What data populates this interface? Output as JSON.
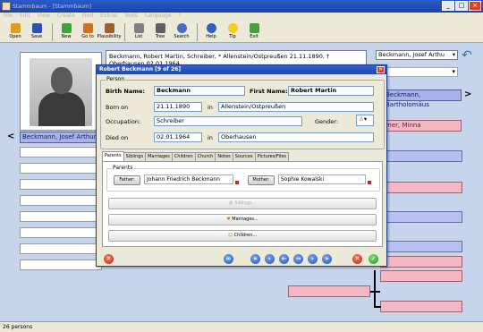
{
  "window": {
    "title": "Stammbaum - [Stammbaum]"
  },
  "menu": [
    "File",
    "Edit",
    "View",
    "Create",
    "Find",
    "Extras",
    "Tools",
    "Language",
    "?"
  ],
  "toolbar": [
    {
      "label": "Open",
      "icon": "open-folder-icon",
      "color": "#d8a020"
    },
    {
      "label": "Save",
      "icon": "save-disk-icon",
      "color": "#3050b0"
    },
    {
      "label": "New",
      "icon": "new-person-icon",
      "color": "#40a040"
    },
    {
      "label": "Go to",
      "icon": "goto-person-icon",
      "color": "#d07020"
    },
    {
      "label": "Plausibility",
      "icon": "plausibility-icon",
      "color": "#a06030"
    },
    {
      "label": "List",
      "icon": "list-icon",
      "color": "#808080"
    },
    {
      "label": "Tree",
      "icon": "tree-icon",
      "color": "#606060"
    },
    {
      "label": "Search",
      "icon": "search-icon",
      "color": "#4070c0"
    },
    {
      "label": "Help",
      "icon": "help-icon",
      "color": "#3060c0"
    },
    {
      "label": "Tip",
      "icon": "lightbulb-icon",
      "color": "#f0d020"
    },
    {
      "label": "Exit",
      "icon": "exit-icon",
      "color": "#40a040"
    }
  ],
  "info": {
    "summary": "Beckmann, Robert Martin, Schreiber, * Allenstein/Ostpreußen 21.11.1890, †",
    "summary2": "Oberhausen 02.01.1964"
  },
  "combo_selected": "Beckmann, Josef Arthu",
  "main_person": "Beckmann, Josef Arthur",
  "right_person": "Beckmann, Bartholomäus",
  "right_pink": "mer, Minna",
  "statusbar": "26 persons",
  "dialog": {
    "title": "Robert Beckmann [9 of 26]",
    "group_person": "Person",
    "birth_name_label": "Birth Name:",
    "birth_name": "Beckmann",
    "first_name_label": "First Name:",
    "first_name": "Robert Martin",
    "born_label": "Born on",
    "born_date": "21.11.1890",
    "in1": "in",
    "born_place": "Allenstein/Ostpreußen",
    "occupation_label": "Occupation:",
    "occupation": "Schreiber",
    "gender_label": "Gender:",
    "died_label": "Died on",
    "died_date": "02.01.1964",
    "in2": "in",
    "died_place": "Oberhausen",
    "tabs": [
      "Parents",
      "Siblings",
      "Marriages",
      "Children",
      "Church",
      "Notes",
      "Sources",
      "Pictures/Files"
    ],
    "group_parents": "Parents",
    "father_btn": "Father:",
    "father": "Johann Friedrich Beckmann",
    "mother_btn": "Mother:",
    "mother": "Sophie Kowalski",
    "siblings_btn": "Siblings...",
    "marriages_btn": "Marriages...",
    "children_btn": "Children..."
  }
}
